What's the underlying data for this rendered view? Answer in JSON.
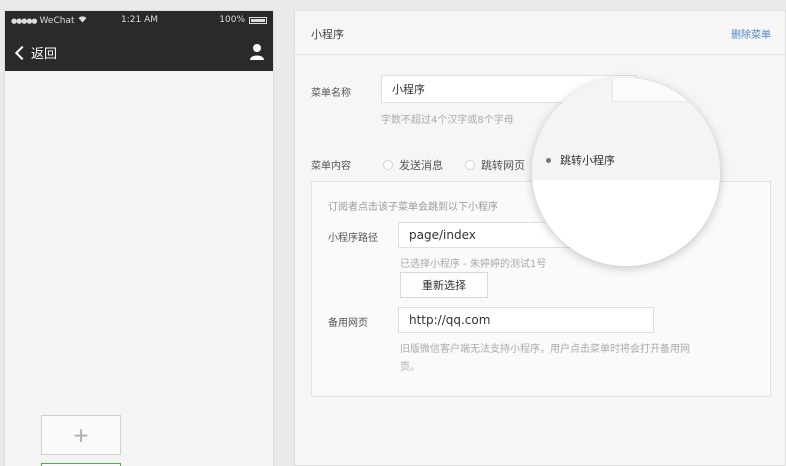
{
  "phone": {
    "status": {
      "signal_icon": "●●●●●",
      "carrier": "WeChat",
      "wifi_icon": "wifi-icon",
      "time": "1:21 AM",
      "battery": "100%"
    },
    "back_label": "返回",
    "add_button_glyph": "+"
  },
  "panel": {
    "title": "小程序",
    "delete_link": "删除菜单",
    "name_label": "菜单名称",
    "name_value": "小程序",
    "name_hint": "字数不超过4个汉字或8个字母",
    "content_label": "菜单内容",
    "options": {
      "send_message": "发送消息",
      "jump_web": "跳转网页",
      "jump_miniprogram": "跳转小程序"
    },
    "selected_option": "jump_miniprogram",
    "box": {
      "intro": "订阅者点击该子菜单会跳到以下小程序",
      "path_label": "小程序路径",
      "path_value": "page/index",
      "selected_hint": "已选择小程序 - 朱婷婷的测试1号",
      "reselect_button": "重新选择",
      "backup_label": "备用网页",
      "backup_value": "http://qq.com",
      "backup_hint_line1": "旧版微信客户端无法支持小程序，用户点击菜单时将会打开备用网",
      "backup_hint_line2": "页。"
    }
  },
  "colors": {
    "accent_link": "#4e87c4",
    "active_green": "#44b549",
    "phone_header": "#2a2a2a"
  }
}
